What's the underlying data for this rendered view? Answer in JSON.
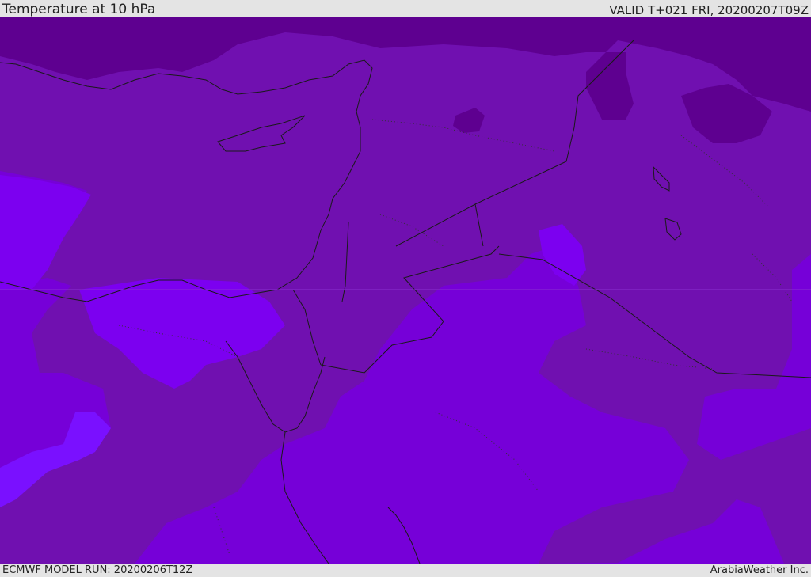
{
  "header": {
    "title": "Temperature at 10 hPa",
    "valid_time": "VALID T+021 FRI, 20200207T09Z"
  },
  "footer": {
    "model_run": "ECMWF MODEL RUN: 20200206T12Z",
    "credit": "ArabiaWeather Inc."
  },
  "map": {
    "fill_colors": {
      "coldest": "#5e0090",
      "cold": "#7010b0",
      "mid": "#7600d8",
      "warm": "#7c00f0",
      "warmest": "#7a10ff"
    },
    "border_color": "#1a1a1a"
  }
}
